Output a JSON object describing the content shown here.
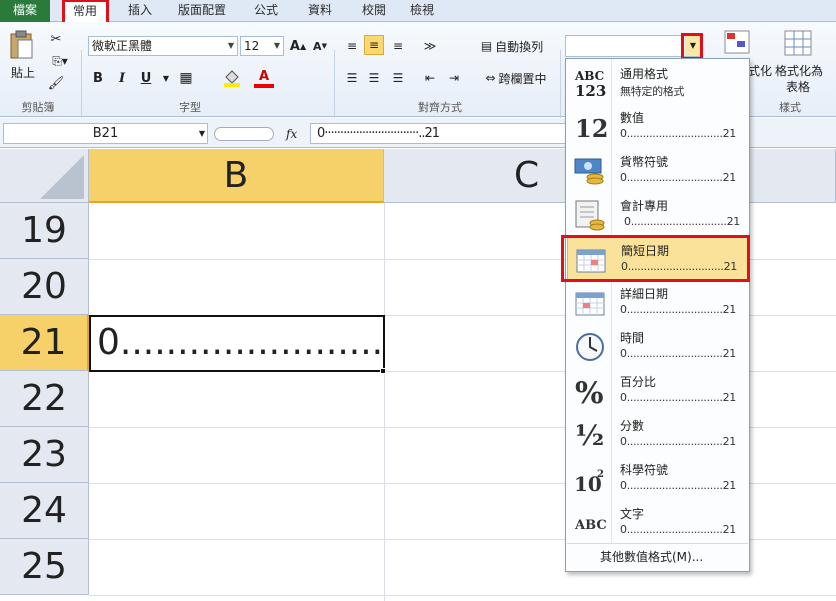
{
  "tabs": [
    "檔案",
    "常用",
    "插入",
    "版面配置",
    "公式",
    "資料",
    "校閱",
    "檢視"
  ],
  "ribbon": {
    "clipboard": {
      "paste": "貼上",
      "group": "剪貼簿"
    },
    "font": {
      "name": "微軟正黑體",
      "size": "12",
      "group": "字型",
      "bold": "B",
      "italic": "I",
      "underline": "U"
    },
    "align": {
      "wrap": "自動換列",
      "merge": "跨欄置中",
      "group": "對齊方式"
    },
    "styles": {
      "cond1": "式化",
      "cond2": "格式化為",
      "table": "表格",
      "group": "樣式"
    }
  },
  "formula": {
    "cell": "B21",
    "fx": "fx",
    "value": "0······························..21"
  },
  "grid": {
    "cols": [
      "B",
      "C"
    ],
    "rows": [
      "19",
      "20",
      "21",
      "22",
      "23",
      "24",
      "25"
    ],
    "b21": "0......................."
  },
  "menu": {
    "items": [
      {
        "label": "通用格式",
        "sample": "無特定的格式",
        "icon": "abc-123-icon"
      },
      {
        "label": "數值",
        "sample": "0..............................21",
        "icon": "number-12-icon"
      },
      {
        "label": "貨幣符號",
        "sample": "0..............................21",
        "icon": "currency-icon"
      },
      {
        "label": "會計專用",
        "sample": "0..............................21",
        "icon": "accounting-icon"
      },
      {
        "label": "簡短日期",
        "sample": "0..............................21",
        "icon": "calendar-short-icon"
      },
      {
        "label": "詳細日期",
        "sample": "0..............................21",
        "icon": "calendar-long-icon"
      },
      {
        "label": "時間",
        "sample": "0..............................21",
        "icon": "clock-icon"
      },
      {
        "label": "百分比",
        "sample": "0..............................21",
        "icon": "percent-icon"
      },
      {
        "label": "分數",
        "sample": "0..............................21",
        "icon": "fraction-icon"
      },
      {
        "label": "科學符號",
        "sample": "0..............................21",
        "icon": "scientific-icon"
      },
      {
        "label": "文字",
        "sample": "0..............................21",
        "icon": "text-abc-icon"
      }
    ],
    "footer": "其他數值格式(M)..."
  },
  "colors": {
    "highlight": "#f8d875",
    "red": "#e0101a",
    "header_active": "#f6d16a"
  }
}
